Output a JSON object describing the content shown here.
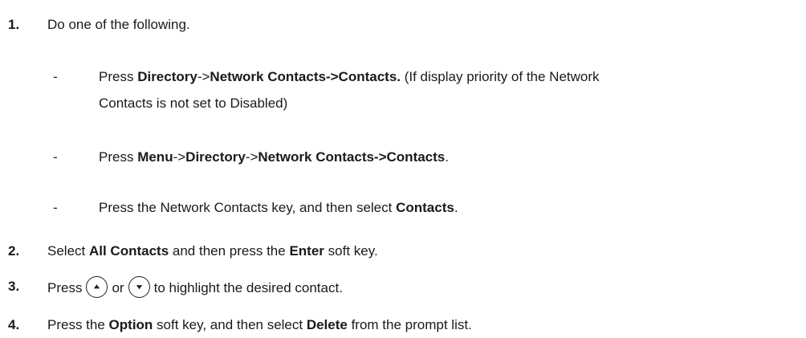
{
  "steps": {
    "s1": {
      "num": "1.",
      "text": "Do one of the following."
    },
    "sub1": {
      "dash": "-",
      "p1": "Press ",
      "b1": "Directory",
      "p2": "->",
      "b2": "Network Contacts->Contacts.",
      "p3": " (If display priority of the Network",
      "line2": "Contacts is not set to Disabled)"
    },
    "sub2": {
      "dash": "-",
      "p1": "Press ",
      "b1": "Menu",
      "p2": "->",
      "b2": "Directory",
      "p3": "->",
      "b3": "Network Contacts->Contacts",
      "p4": "."
    },
    "sub3": {
      "dash": "-",
      "p1": "Press the Network Contacts key, and then select ",
      "b1": "Contacts",
      "p2": "."
    },
    "s2": {
      "num": "2.",
      "p1": "Select ",
      "b1": "All Contacts",
      "p2": " and then press the ",
      "b2": "Enter",
      "p3": " soft key."
    },
    "s3": {
      "num": "3.",
      "p1": "Press",
      "p2": "or",
      "p3": "to highlight the desired contact.",
      "icon_up": "up-arrow-key-icon",
      "icon_down": "down-arrow-key-icon"
    },
    "s4": {
      "num": "4.",
      "p1": "Press the ",
      "b1": "Option",
      "p2": " soft key, and then select ",
      "b2": "Delete",
      "p3": " from the prompt list."
    }
  }
}
